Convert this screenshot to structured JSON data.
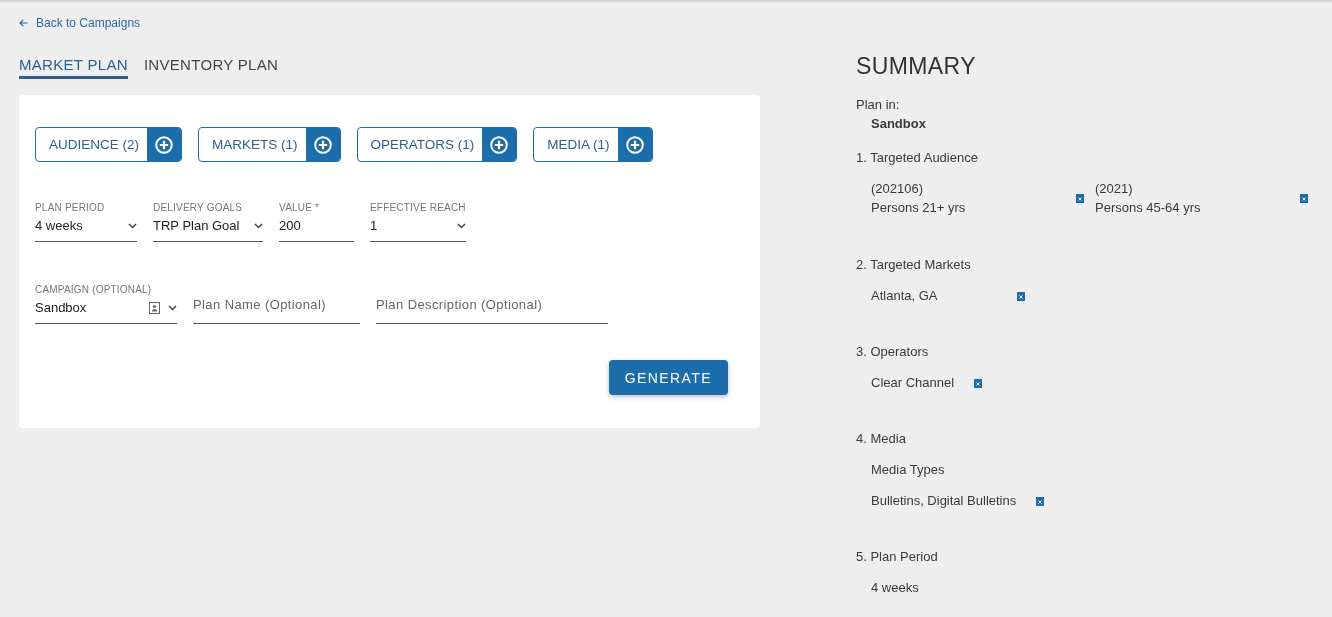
{
  "back_link": {
    "label": "Back to Campaigns"
  },
  "tabs": [
    {
      "label": "MARKET PLAN",
      "selected": true
    },
    {
      "label": "INVENTORY PLAN",
      "selected": false
    }
  ],
  "selectors": [
    {
      "label": "AUDIENCE (2)"
    },
    {
      "label": "MARKETS (1)"
    },
    {
      "label": "OPERATORS (1)"
    },
    {
      "label": "MEDIA (1)"
    }
  ],
  "plan_fields": [
    {
      "kind": "dropdown",
      "label": "PLAN PERIOD",
      "value": "4 weeks"
    },
    {
      "kind": "dropdown",
      "label": "DELIVERY GOALS",
      "value": "TRP Plan Goal"
    },
    {
      "kind": "text",
      "label": "VALUE *",
      "value": "200"
    },
    {
      "kind": "dropdown",
      "label": "EFFECTIVE REACH",
      "value": "1"
    }
  ],
  "detail_fields": [
    {
      "kind": "campaign",
      "label": "CAMPAIGN (OPTIONAL)",
      "value": "Sandbox"
    },
    {
      "kind": "text",
      "placeholder": "Plan Name (Optional)"
    },
    {
      "kind": "text",
      "placeholder": "Plan Description (Optional)"
    }
  ],
  "generate_button": {
    "label": "GENERATE"
  },
  "summary": {
    "title": "SUMMARY",
    "plan_in": {
      "label": "Plan in:",
      "value": "Sandbox"
    },
    "sections": [
      {
        "kind": "audience",
        "heading": "1. Targeted Audience",
        "items": [
          {
            "code": "(202106)",
            "text": "Persons 21+ yrs",
            "removable": true
          },
          {
            "code": "(2021)",
            "text": "Persons 45-64 yrs",
            "removable": true
          }
        ]
      },
      {
        "kind": "markets",
        "heading": "2. Targeted Markets",
        "items": [
          {
            "text": "Atlanta, GA",
            "removable": true
          }
        ]
      },
      {
        "kind": "operators",
        "heading": "3. Operators",
        "items": [
          {
            "text": "Clear Channel",
            "removable": true
          }
        ]
      },
      {
        "kind": "media",
        "heading": "4. Media",
        "subheading": "Media Types",
        "items": [
          {
            "text": "Bulletins, Digital Bulletins",
            "removable": true
          }
        ]
      },
      {
        "kind": "period",
        "heading": "5. Plan Period",
        "items": [
          {
            "text": "4 weeks",
            "removable": false
          }
        ]
      }
    ]
  }
}
